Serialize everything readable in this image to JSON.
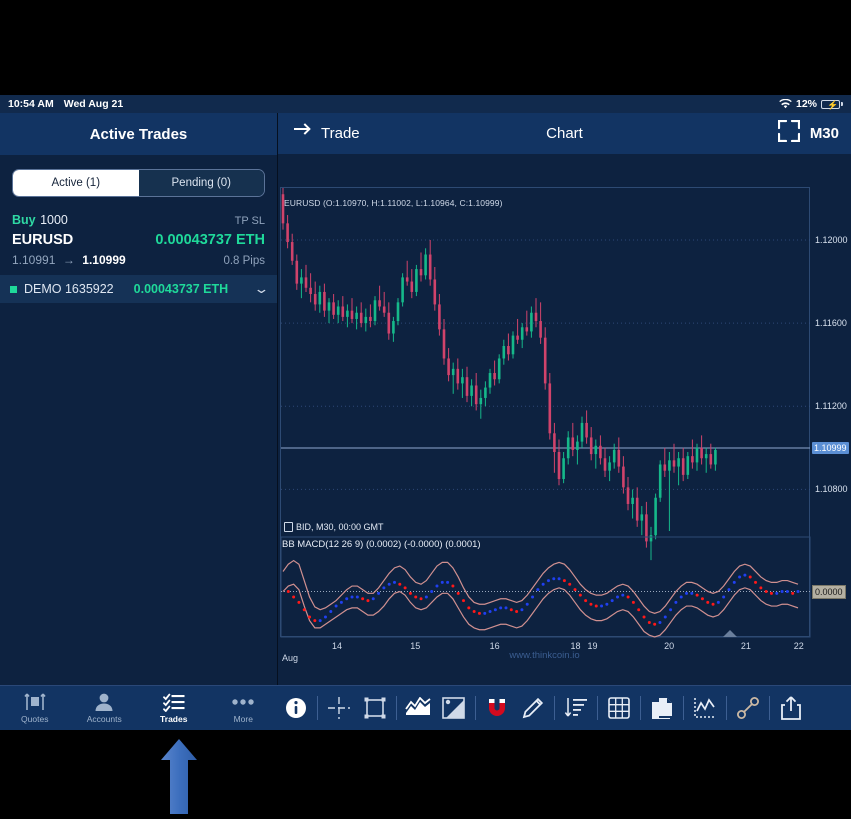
{
  "statusbar": {
    "time": "10:54 AM",
    "date": "Wed Aug 21",
    "battery_percent": "12%",
    "wifi_icon": "wifi-icon",
    "battery_icon": "battery-charging-icon"
  },
  "sidebar": {
    "title": "Active Trades",
    "segmented": {
      "active_label": "Active (1)",
      "pending_label": "Pending (0)",
      "selected": "Active (1)"
    },
    "trade": {
      "side": "Buy",
      "volume": "1000",
      "tpsl": "TP SL",
      "symbol": "EURUSD",
      "pnl": "0.00043737 ETH",
      "open_price": "1.10991",
      "arrow": "→",
      "current_price": "1.10999",
      "pips": "0.8 Pips"
    },
    "account": {
      "name": "DEMO 1635922",
      "value": "0.00043737 ETH",
      "chevron_icon": "chevron-down-icon",
      "status_icon": "status-square-icon"
    }
  },
  "chart_header": {
    "trade_label": "Trade",
    "trade_icon": "swap-arrows-icon",
    "title": "Chart",
    "fullscreen_icon": "fullscreen-icon",
    "timeframe": "M30"
  },
  "chart_data": {
    "type": "line",
    "title": "EURUSD (O:1.10970, H:1.11002, L:1.10964, C:1.10999)",
    "symbol": "EURUSD",
    "ohlc": {
      "open": "1.10970",
      "high": "1.11002",
      "low": "1.10964",
      "close": "1.10999"
    },
    "source_label": "BID, M30, 00:00 GMT",
    "watermark": "www.thinkcoin.io",
    "xlabel": "Aug",
    "grid": true,
    "legend": "none",
    "price_axis": {
      "ticks": [
        "1.12000",
        "1.11600",
        "1.11200",
        "1.10800"
      ],
      "current_price": "1.10999",
      "ylim": [
        1.106,
        1.1225
      ]
    },
    "time_axis": {
      "ticks": [
        "14",
        "15",
        "16",
        "18",
        "19",
        "20",
        "21",
        "22"
      ],
      "tick_positions": [
        0.102,
        0.25,
        0.4,
        0.553,
        0.585,
        0.73,
        0.875,
        0.975
      ]
    },
    "candles": [
      [
        1.1222,
        1.1225,
        1.1205,
        1.1208
      ],
      [
        1.1208,
        1.1212,
        1.1196,
        1.1199
      ],
      [
        1.1199,
        1.1203,
        1.1188,
        1.119
      ],
      [
        1.119,
        1.1193,
        1.1176,
        1.1179
      ],
      [
        1.1179,
        1.1186,
        1.1172,
        1.1182
      ],
      [
        1.1182,
        1.1188,
        1.1175,
        1.1177
      ],
      [
        1.1177,
        1.1184,
        1.117,
        1.1174
      ],
      [
        1.1174,
        1.118,
        1.1166,
        1.1169
      ],
      [
        1.1169,
        1.1178,
        1.1165,
        1.1175
      ],
      [
        1.1175,
        1.1179,
        1.1163,
        1.1166
      ],
      [
        1.1166,
        1.1172,
        1.116,
        1.117
      ],
      [
        1.117,
        1.1174,
        1.1162,
        1.1164
      ],
      [
        1.1164,
        1.1171,
        1.116,
        1.1168
      ],
      [
        1.1168,
        1.1173,
        1.1161,
        1.1163
      ],
      [
        1.1163,
        1.1169,
        1.1158,
        1.1166
      ],
      [
        1.1166,
        1.1172,
        1.116,
        1.1162
      ],
      [
        1.1162,
        1.1168,
        1.1157,
        1.1165
      ],
      [
        1.1165,
        1.117,
        1.1158,
        1.116
      ],
      [
        1.116,
        1.1167,
        1.1156,
        1.1163
      ],
      [
        1.1163,
        1.1169,
        1.1158,
        1.1161
      ],
      [
        1.1161,
        1.1173,
        1.1159,
        1.1171
      ],
      [
        1.1171,
        1.1178,
        1.1166,
        1.1168
      ],
      [
        1.1168,
        1.1175,
        1.1163,
        1.1165
      ],
      [
        1.1165,
        1.117,
        1.1152,
        1.1155
      ],
      [
        1.1155,
        1.1163,
        1.1151,
        1.1161
      ],
      [
        1.1161,
        1.1172,
        1.1159,
        1.117
      ],
      [
        1.117,
        1.1184,
        1.1168,
        1.1182
      ],
      [
        1.1182,
        1.119,
        1.1178,
        1.118
      ],
      [
        1.118,
        1.1186,
        1.1172,
        1.1175
      ],
      [
        1.1175,
        1.1188,
        1.1173,
        1.1186
      ],
      [
        1.1186,
        1.1194,
        1.118,
        1.1183
      ],
      [
        1.1183,
        1.1196,
        1.1181,
        1.1193
      ],
      [
        1.1193,
        1.12,
        1.1178,
        1.1181
      ],
      [
        1.1181,
        1.1187,
        1.1166,
        1.1169
      ],
      [
        1.1169,
        1.1174,
        1.1154,
        1.1157
      ],
      [
        1.1157,
        1.1162,
        1.114,
        1.1143
      ],
      [
        1.1143,
        1.1148,
        1.1132,
        1.1135
      ],
      [
        1.1135,
        1.1141,
        1.1126,
        1.1138
      ],
      [
        1.1138,
        1.1143,
        1.1128,
        1.1131
      ],
      [
        1.1131,
        1.1138,
        1.1124,
        1.1134
      ],
      [
        1.1134,
        1.1139,
        1.1122,
        1.1125
      ],
      [
        1.1125,
        1.1133,
        1.112,
        1.113
      ],
      [
        1.113,
        1.1136,
        1.1118,
        1.1121
      ],
      [
        1.1121,
        1.1128,
        1.1114,
        1.1124
      ],
      [
        1.1124,
        1.1132,
        1.112,
        1.1129
      ],
      [
        1.1129,
        1.1138,
        1.1126,
        1.1136
      ],
      [
        1.1136,
        1.1142,
        1.113,
        1.1133
      ],
      [
        1.1133,
        1.1145,
        1.1131,
        1.1143
      ],
      [
        1.1143,
        1.1152,
        1.114,
        1.1149
      ],
      [
        1.1149,
        1.1155,
        1.1142,
        1.1145
      ],
      [
        1.1145,
        1.1156,
        1.1143,
        1.1154
      ],
      [
        1.1154,
        1.1162,
        1.115,
        1.1152
      ],
      [
        1.1152,
        1.116,
        1.1148,
        1.1158
      ],
      [
        1.1158,
        1.1166,
        1.1154,
        1.1156
      ],
      [
        1.1156,
        1.1168,
        1.1153,
        1.1165
      ],
      [
        1.1165,
        1.1172,
        1.1158,
        1.1161
      ],
      [
        1.1161,
        1.117,
        1.115,
        1.1153
      ],
      [
        1.1153,
        1.1158,
        1.1128,
        1.1131
      ],
      [
        1.1131,
        1.1136,
        1.1104,
        1.1107
      ],
      [
        1.1107,
        1.1112,
        1.1088,
        1.1098
      ],
      [
        1.1098,
        1.1104,
        1.1082,
        1.1085
      ],
      [
        1.1085,
        1.1098,
        1.1083,
        1.1095
      ],
      [
        1.1095,
        1.1108,
        1.1092,
        1.1105
      ],
      [
        1.1105,
        1.1112,
        1.1096,
        1.1099
      ],
      [
        1.1099,
        1.1106,
        1.1092,
        1.1103
      ],
      [
        1.1103,
        1.1115,
        1.11,
        1.1112
      ],
      [
        1.1112,
        1.1118,
        1.1102,
        1.1105
      ],
      [
        1.1105,
        1.111,
        1.1094,
        1.1097
      ],
      [
        1.1097,
        1.1104,
        1.109,
        1.1101
      ],
      [
        1.1101,
        1.1106,
        1.1092,
        1.1095
      ],
      [
        1.1095,
        1.11,
        1.1086,
        1.1089
      ],
      [
        1.1089,
        1.1096,
        1.1084,
        1.1093
      ],
      [
        1.1093,
        1.1102,
        1.109,
        1.1099
      ],
      [
        1.1099,
        1.1105,
        1.1088,
        1.1091
      ],
      [
        1.1091,
        1.1096,
        1.1078,
        1.1081
      ],
      [
        1.1081,
        1.1086,
        1.107,
        1.1073
      ],
      [
        1.1073,
        1.108,
        1.1066,
        1.1076
      ],
      [
        1.1076,
        1.1081,
        1.1062,
        1.1065
      ],
      [
        1.1065,
        1.1072,
        1.1058,
        1.1068
      ],
      [
        1.1068,
        1.1074,
        1.1052,
        1.1055
      ],
      [
        1.1055,
        1.1062,
        1.1046,
        1.1058
      ],
      [
        1.1058,
        1.1078,
        1.1056,
        1.1076
      ],
      [
        1.1076,
        1.1094,
        1.1074,
        1.1092
      ],
      [
        1.1092,
        1.11,
        1.1086,
        1.1089
      ],
      [
        1.1089,
        1.1098,
        1.106,
        1.1094
      ],
      [
        1.1094,
        1.1102,
        1.1088,
        1.1091
      ],
      [
        1.1091,
        1.1098,
        1.1082,
        1.1095
      ],
      [
        1.1095,
        1.11,
        1.1084,
        1.1087
      ],
      [
        1.1087,
        1.1098,
        1.1085,
        1.1096
      ],
      [
        1.1096,
        1.1104,
        1.109,
        1.1093
      ],
      [
        1.1093,
        1.1102,
        1.1089,
        1.11
      ],
      [
        1.11,
        1.1106,
        1.1092,
        1.1095
      ],
      [
        1.1095,
        1.11,
        1.1088,
        1.1097
      ],
      [
        1.1097,
        1.1102,
        1.109,
        1.1092
      ],
      [
        1.1092,
        1.11,
        1.1089,
        1.1099
      ]
    ],
    "colors": {
      "up": "#16b88a",
      "down": "#d0436b",
      "background": "#0d2240",
      "grid": "#38558a"
    },
    "indicator": {
      "name": "BB MACD(12 26 9)",
      "values": [
        "(0.0002)",
        "(-0.0000)",
        "(0.0001)"
      ],
      "zero_label": "0.0000",
      "upper_band": [
        0.72,
        0.8,
        0.84,
        0.8,
        0.62,
        0.44,
        0.33,
        0.3,
        0.32,
        0.36,
        0.4,
        0.46,
        0.52,
        0.56,
        0.56,
        0.52,
        0.48,
        0.48,
        0.54,
        0.62,
        0.7,
        0.76,
        0.78,
        0.74,
        0.66,
        0.6,
        0.58,
        0.62,
        0.7,
        0.78,
        0.82,
        0.82,
        0.76,
        0.66,
        0.54,
        0.44,
        0.38,
        0.36,
        0.36,
        0.38,
        0.4,
        0.42,
        0.42,
        0.4,
        0.38,
        0.4,
        0.46,
        0.54,
        0.62,
        0.7,
        0.76,
        0.8,
        0.82,
        0.8,
        0.74,
        0.66,
        0.58,
        0.52,
        0.48,
        0.46,
        0.46,
        0.48,
        0.52,
        0.56,
        0.58,
        0.56,
        0.5,
        0.42,
        0.34,
        0.28,
        0.26,
        0.28,
        0.34,
        0.42,
        0.5,
        0.56,
        0.6,
        0.6,
        0.58,
        0.54,
        0.5,
        0.48,
        0.5,
        0.56,
        0.64,
        0.72,
        0.78,
        0.8,
        0.78,
        0.72,
        0.66,
        0.62,
        0.6,
        0.6,
        0.62,
        0.62,
        0.6,
        0.58
      ],
      "lower_band": [
        0.5,
        0.56,
        0.58,
        0.52,
        0.34,
        0.18,
        0.1,
        0.1,
        0.14,
        0.18,
        0.22,
        0.26,
        0.3,
        0.32,
        0.32,
        0.28,
        0.24,
        0.24,
        0.28,
        0.34,
        0.42,
        0.48,
        0.5,
        0.46,
        0.38,
        0.32,
        0.3,
        0.32,
        0.38,
        0.44,
        0.48,
        0.48,
        0.42,
        0.32,
        0.22,
        0.14,
        0.1,
        0.08,
        0.08,
        0.1,
        0.12,
        0.14,
        0.14,
        0.12,
        0.1,
        0.12,
        0.18,
        0.26,
        0.34,
        0.42,
        0.48,
        0.52,
        0.54,
        0.52,
        0.46,
        0.38,
        0.3,
        0.24,
        0.2,
        0.18,
        0.18,
        0.2,
        0.24,
        0.28,
        0.3,
        0.28,
        0.22,
        0.14,
        0.06,
        0.02,
        0.0,
        0.02,
        0.08,
        0.16,
        0.24,
        0.3,
        0.34,
        0.34,
        0.32,
        0.28,
        0.24,
        0.22,
        0.24,
        0.3,
        0.38,
        0.46,
        0.52,
        0.54,
        0.52,
        0.46,
        0.4,
        0.36,
        0.34,
        0.34,
        0.36,
        0.36,
        0.34,
        0.32
      ],
      "macd_line": [
        0.56,
        0.5,
        0.44,
        0.38,
        0.3,
        0.22,
        0.18,
        0.18,
        0.22,
        0.28,
        0.34,
        0.38,
        0.42,
        0.44,
        0.44,
        0.42,
        0.4,
        0.42,
        0.48,
        0.54,
        0.58,
        0.6,
        0.58,
        0.54,
        0.48,
        0.44,
        0.42,
        0.44,
        0.5,
        0.56,
        0.6,
        0.6,
        0.56,
        0.48,
        0.4,
        0.32,
        0.28,
        0.26,
        0.26,
        0.28,
        0.3,
        0.32,
        0.32,
        0.3,
        0.28,
        0.3,
        0.36,
        0.44,
        0.52,
        0.58,
        0.62,
        0.64,
        0.64,
        0.62,
        0.58,
        0.52,
        0.46,
        0.4,
        0.36,
        0.34,
        0.34,
        0.36,
        0.4,
        0.44,
        0.46,
        0.44,
        0.38,
        0.3,
        0.22,
        0.16,
        0.14,
        0.16,
        0.22,
        0.3,
        0.38,
        0.44,
        0.48,
        0.48,
        0.46,
        0.42,
        0.38,
        0.36,
        0.38,
        0.44,
        0.52,
        0.6,
        0.66,
        0.68,
        0.66,
        0.6,
        0.54,
        0.5,
        0.48,
        0.48,
        0.5,
        0.5,
        0.48,
        0.5
      ],
      "colors": {
        "band": "#d09090",
        "macd_up": "#2040f0",
        "macd_down": "#ff1818",
        "zero_line": "#9aa8bd"
      }
    }
  },
  "bottom_tabs": [
    {
      "label": "Quotes",
      "icon": "quotes-icon",
      "active": false
    },
    {
      "label": "Accounts",
      "icon": "accounts-person-icon",
      "active": false
    },
    {
      "label": "Trades",
      "icon": "trades-checklist-icon",
      "active": true
    },
    {
      "label": "More",
      "icon": "more-dots-icon",
      "active": false
    }
  ],
  "chart_tools": [
    {
      "name": "info-icon"
    },
    {
      "name": "crosshair-icon"
    },
    {
      "name": "rectangle-shape-icon"
    },
    {
      "name": "chart-type-area-icon"
    },
    {
      "name": "color-palette-icon"
    },
    {
      "name": "magnet-icon"
    },
    {
      "name": "pencil-icon"
    },
    {
      "name": "sort-descending-icon"
    },
    {
      "name": "grid-table-icon"
    },
    {
      "name": "layers-copy-icon"
    },
    {
      "name": "indicator-chart-icon"
    },
    {
      "name": "link-chain-icon"
    },
    {
      "name": "share-export-icon"
    }
  ],
  "annotation": {
    "arrow_icon": "up-arrow-annotation",
    "color": "#3b72c4",
    "points_to": "Trades"
  }
}
